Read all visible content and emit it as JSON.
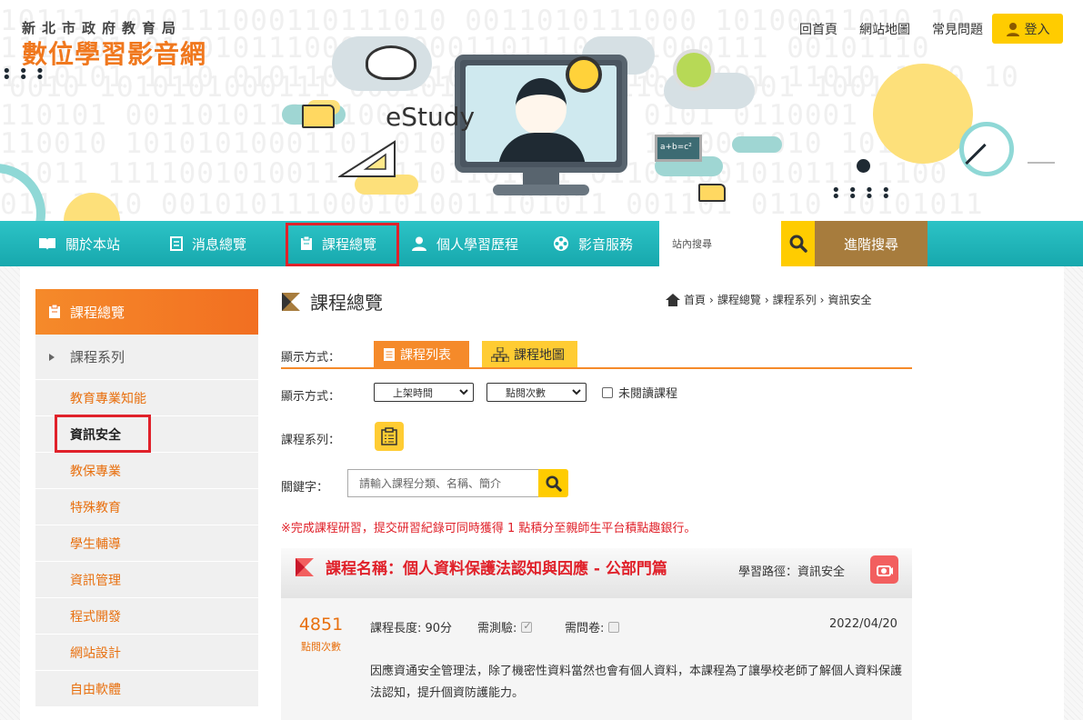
{
  "header": {
    "agency": "新北市政府教育局",
    "site_name": "數位學習影音網",
    "hero_text": "eStudy",
    "board_text": "a+b=c²",
    "binary_rows": [
      "10111 1010111000110111010 0011010111000 10100011010 10",
      "1111001 01101011100010100011011101001000111 00101110",
      "1 10101 1110 010110110111010011 11110 01001 11010 1010 10",
      "0010 1010101000111 0001010110001 01101100001 1001 010",
      "110101 0011010110111001 01110 01001 0101 0110001 10",
      "110010 10101010001101 0101011 01110 101001 010 1010",
      "01011 1111001010011 011101101011 011011001010111 1100",
      "011 1110 0010101110001010011101011 001101 0110 10101011"
    ]
  },
  "top_links": [
    "回首頁",
    "網站地圖",
    "常見問題"
  ],
  "login_label": "登入",
  "nav": {
    "items": [
      {
        "label": "關於本站",
        "icon": "book-icon"
      },
      {
        "label": "消息總覽",
        "icon": "document-icon"
      },
      {
        "label": "課程總覽",
        "icon": "clipboard-icon"
      },
      {
        "label": "個人學習歷程",
        "icon": "user-icon"
      },
      {
        "label": "影音服務",
        "icon": "film-reel-icon"
      }
    ],
    "search_placeholder": "站內搜尋",
    "advanced_search": "進階搜尋"
  },
  "sidebar": {
    "title": "課程總覽",
    "parent": "課程系列",
    "items": [
      "教育專業知能",
      "資訊安全",
      "教保專業",
      "特殊教育",
      "學生輔導",
      "資訊管理",
      "程式開發",
      "網站設計",
      "自由軟體"
    ],
    "active_index": 1
  },
  "main": {
    "title": "課程總覽",
    "breadcrumb": [
      "首頁",
      "課程總覽",
      "課程系列",
      "資訊安全"
    ],
    "display_label": "顯示方式：",
    "tab_list": "課程列表",
    "tab_map": "課程地圖",
    "sort_label": "顯示方式：",
    "sort_time": "上架時間",
    "sort_views": "點閱次數",
    "unread_label": "未閱讀課程",
    "series_label": "課程系列：",
    "keyword_label": "關鍵字：",
    "keyword_placeholder": "請輸入課程分類、名稱、簡介",
    "notice": "※完成課程研習，提交研習紀錄可同時獲得 1 點積分至親師生平台積點趣銀行。"
  },
  "course": {
    "title": "課程名稱：個人資料保護法認知與因應 - 公部門篇",
    "path_label": "學習路徑：資訊安全",
    "views": "4851",
    "views_label": "點閱次數",
    "length": "課程長度: 90分",
    "test_label": "需測驗:",
    "test_checked": true,
    "survey_label": "需問卷:",
    "survey_checked": false,
    "date": "2022/04/20",
    "description": "因應資通安全管理法，除了機密性資料當然也會有個人資料，本課程為了讓學校老師了解個人資料保護法認知，提升個資防護能力。"
  },
  "colors": {
    "teal_nav": "#1fb6ba",
    "orange": "#f58a2a",
    "yellow": "#ffcc00",
    "brown": "#a77c3d",
    "red_highlight": "#e0212a"
  }
}
